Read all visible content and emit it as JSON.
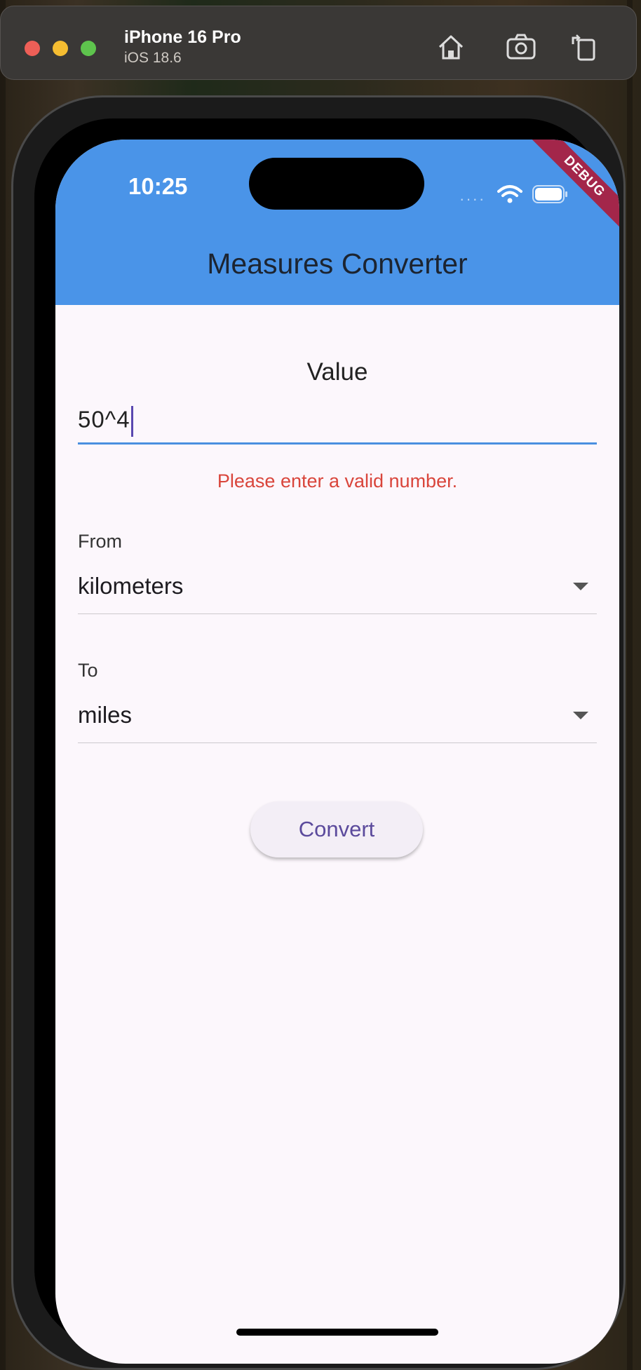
{
  "simulator": {
    "device_name": "iPhone 16 Pro",
    "os_version": "iOS 18.6",
    "toolbar_icons": [
      "home-icon",
      "screenshot-icon",
      "rotate-icon"
    ]
  },
  "status_bar": {
    "time": "10:25",
    "debug_banner": "DEBUG"
  },
  "app_bar": {
    "title": "Measures Converter",
    "color": "#4a94e8"
  },
  "form": {
    "value_label": "Value",
    "value_input": "50^4",
    "error_text": "Please enter a valid number.",
    "from_label": "From",
    "from_value": "kilometers",
    "to_label": "To",
    "to_value": "miles",
    "convert_label": "Convert"
  },
  "colors": {
    "error": "#d9453b",
    "accent": "#5b4a9c",
    "input_underline": "#4a8fe0"
  }
}
